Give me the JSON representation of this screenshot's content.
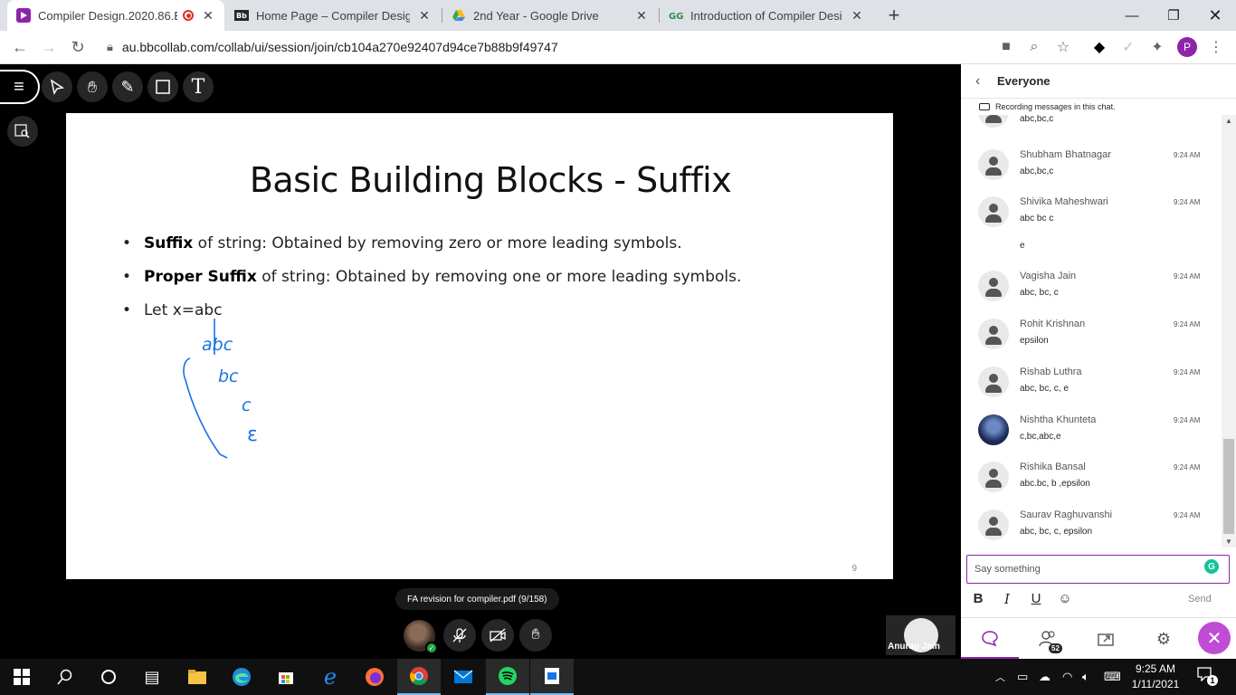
{
  "browser": {
    "tabs": [
      {
        "title": "Compiler Design.2020.86.BT-",
        "active": true
      },
      {
        "title": "Home Page – Compiler Design.2C",
        "active": false
      },
      {
        "title": "2nd Year - Google Drive",
        "active": false
      },
      {
        "title": "Introduction of Compiler Design",
        "active": false
      }
    ],
    "url": "au.bbcollab.com/collab/ui/session/join/cb104a270e92407d94ce7b88b9f49747",
    "profile_initial": "P"
  },
  "slide": {
    "title": "Basic Building Blocks - Suffix",
    "bullets": [
      {
        "bold": "Suffix",
        "rest": " of string: Obtained by removing zero or more leading symbols."
      },
      {
        "bold": "Proper Suffix",
        "rest": " of string: Obtained by removing one or more leading symbols."
      },
      {
        "bold": "",
        "rest": "Let x=abc"
      }
    ],
    "handwriting": [
      "abc",
      "bc",
      "c",
      "ε"
    ],
    "page_number": "9"
  },
  "presentation": {
    "file_label": "FA revision for compiler.pdf   (9/158)",
    "participant_name": "Anurag Jain"
  },
  "chat": {
    "header": "Everyone",
    "recording_note": "Recording messages in this chat.",
    "messages": [
      {
        "name": "",
        "time": "",
        "lines": [
          "abc,bc,c"
        ]
      },
      {
        "name": "Shubham Bhatnagar",
        "time": "9:24 AM",
        "lines": [
          "abc,bc,c"
        ]
      },
      {
        "name": "Shivika Maheshwari",
        "time": "9:24 AM",
        "lines": [
          "abc bc c",
          "e"
        ]
      },
      {
        "name": "Vagisha Jain",
        "time": "9:24 AM",
        "lines": [
          "abc, bc, c"
        ]
      },
      {
        "name": "Rohit Krishnan",
        "time": "9:24 AM",
        "lines": [
          "epsilon"
        ]
      },
      {
        "name": "Rishab Luthra",
        "time": "9:24 AM",
        "lines": [
          "abc, bc, c, e"
        ]
      },
      {
        "name": "Nishtha Khunteta",
        "time": "9:24 AM",
        "lines": [
          "c,bc,abc,e"
        ]
      },
      {
        "name": "Rishika Bansal",
        "time": "9:24 AM",
        "lines": [
          "abc.bc, b ,epsilon"
        ]
      },
      {
        "name": "Saurav Raghuvanshi",
        "time": "9:24 AM",
        "lines": [
          "abc, bc, c, epsilon"
        ]
      }
    ],
    "input_placeholder": "Say something",
    "send_label": "Send",
    "participant_count": "52"
  },
  "taskbar": {
    "time": "9:25 AM",
    "date": "1/11/2021",
    "notification_count": "1"
  },
  "colors": {
    "accent": "#8e24aa",
    "handwriting": "#1a73e8"
  }
}
